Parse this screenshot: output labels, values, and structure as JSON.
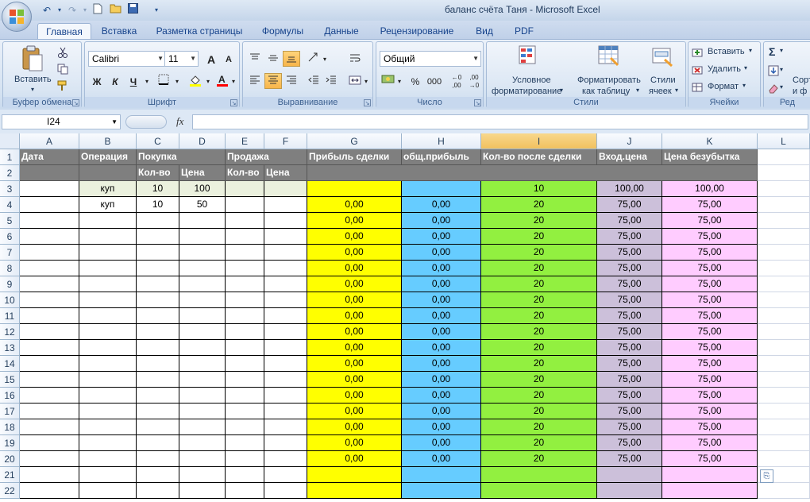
{
  "window": {
    "title": "баланс счёта Таня - Microsoft Excel"
  },
  "tabs": [
    "Главная",
    "Вставка",
    "Разметка страницы",
    "Формулы",
    "Данные",
    "Рецензирование",
    "Вид",
    "PDF"
  ],
  "ribbon": {
    "clipboard": {
      "label": "Буфер обмена",
      "paste": "Вставить"
    },
    "font": {
      "label": "Шрифт",
      "name": "Calibri",
      "size": "11",
      "bold": "Ж",
      "italic": "К",
      "underline": "Ч",
      "grow": "A",
      "shrink": "A"
    },
    "alignment": {
      "label": "Выравнивание"
    },
    "number": {
      "label": "Число",
      "format": "Общий",
      "percent": "%",
      "thousands": "000"
    },
    "styles": {
      "label": "Стили",
      "conditional": [
        "Условное",
        "форматирование"
      ],
      "table": [
        "Форматировать",
        "как таблицу"
      ],
      "cell_styles": [
        "Стили",
        "ячеек"
      ]
    },
    "cells": {
      "label": "Ячейки",
      "insert": "Вставить",
      "delete": "Удалить",
      "format": "Формат"
    },
    "editing": {
      "sort": [
        "Сорт",
        "и ф"
      ],
      "label": "Ред"
    }
  },
  "formula_bar": {
    "name_box": "I24",
    "fx": "fx",
    "formula": ""
  },
  "columns": [
    "A",
    "B",
    "C",
    "D",
    "E",
    "F",
    "G",
    "H",
    "I",
    "J",
    "K",
    "L"
  ],
  "selected_column": "I",
  "rows": [
    "1",
    "2",
    "3",
    "4",
    "5",
    "6",
    "7",
    "8",
    "9",
    "10",
    "11",
    "12",
    "13",
    "14",
    "15",
    "16",
    "17",
    "18",
    "19",
    "20",
    "21",
    "22"
  ],
  "headers": {
    "A1": "Дата",
    "B1": "Операция",
    "C1": "Покупка",
    "E1": "Продажа",
    "G1": "Прибыль сделки",
    "H1": "общ.прибыль",
    "I1": "Кол-во после сделки",
    "J1": "Вход.цена",
    "K1": "Цена  безубытка",
    "C2": "Кол-во",
    "D2": "Цена",
    "E2": "Кол-во",
    "F2": "Цена"
  },
  "data_rows": [
    {
      "B": "куп",
      "C": "10",
      "D": "100",
      "G": "",
      "H": "",
      "I": "10",
      "J": "100,00",
      "K": "100,00"
    },
    {
      "B": "куп",
      "C": "10",
      "D": "50",
      "G": "0,00",
      "H": "0,00",
      "I": "20",
      "J": "75,00",
      "K": "75,00"
    },
    {
      "G": "0,00",
      "H": "0,00",
      "I": "20",
      "J": "75,00",
      "K": "75,00"
    },
    {
      "G": "0,00",
      "H": "0,00",
      "I": "20",
      "J": "75,00",
      "K": "75,00"
    },
    {
      "G": "0,00",
      "H": "0,00",
      "I": "20",
      "J": "75,00",
      "K": "75,00"
    },
    {
      "G": "0,00",
      "H": "0,00",
      "I": "20",
      "J": "75,00",
      "K": "75,00"
    },
    {
      "G": "0,00",
      "H": "0,00",
      "I": "20",
      "J": "75,00",
      "K": "75,00"
    },
    {
      "G": "0,00",
      "H": "0,00",
      "I": "20",
      "J": "75,00",
      "K": "75,00"
    },
    {
      "G": "0,00",
      "H": "0,00",
      "I": "20",
      "J": "75,00",
      "K": "75,00"
    },
    {
      "G": "0,00",
      "H": "0,00",
      "I": "20",
      "J": "75,00",
      "K": "75,00"
    },
    {
      "G": "0,00",
      "H": "0,00",
      "I": "20",
      "J": "75,00",
      "K": "75,00"
    },
    {
      "G": "0,00",
      "H": "0,00",
      "I": "20",
      "J": "75,00",
      "K": "75,00"
    },
    {
      "G": "0,00",
      "H": "0,00",
      "I": "20",
      "J": "75,00",
      "K": "75,00"
    },
    {
      "G": "0,00",
      "H": "0,00",
      "I": "20",
      "J": "75,00",
      "K": "75,00"
    },
    {
      "G": "0,00",
      "H": "0,00",
      "I": "20",
      "J": "75,00",
      "K": "75,00"
    },
    {
      "G": "0,00",
      "H": "0,00",
      "I": "20",
      "J": "75,00",
      "K": "75,00"
    },
    {
      "G": "0,00",
      "H": "0,00",
      "I": "20",
      "J": "75,00",
      "K": "75,00"
    },
    {
      "G": "0,00",
      "H": "0,00",
      "I": "20",
      "J": "75,00",
      "K": "75,00"
    },
    {
      "G": "",
      "H": "",
      "I": "",
      "J": "",
      "K": ""
    },
    {
      "G": "",
      "H": "",
      "I": "",
      "J": "",
      "K": ""
    }
  ],
  "colors": {
    "yellow": "#ffff00",
    "blue": "#66ccff",
    "green": "#92f040",
    "purple": "#ccc0da",
    "pink": "#ffccff",
    "header_gray": "#7f7f7f",
    "light_green": "#ebf1de"
  },
  "icons": [
    "office-button-icon",
    "undo-icon",
    "redo-icon",
    "new-file-icon",
    "open-folder-icon",
    "save-icon",
    "paste-icon",
    "cut-icon",
    "copy-icon",
    "format-painter-icon",
    "fill-color-icon",
    "font-color-icon",
    "borders-icon",
    "paste-options-icon"
  ]
}
